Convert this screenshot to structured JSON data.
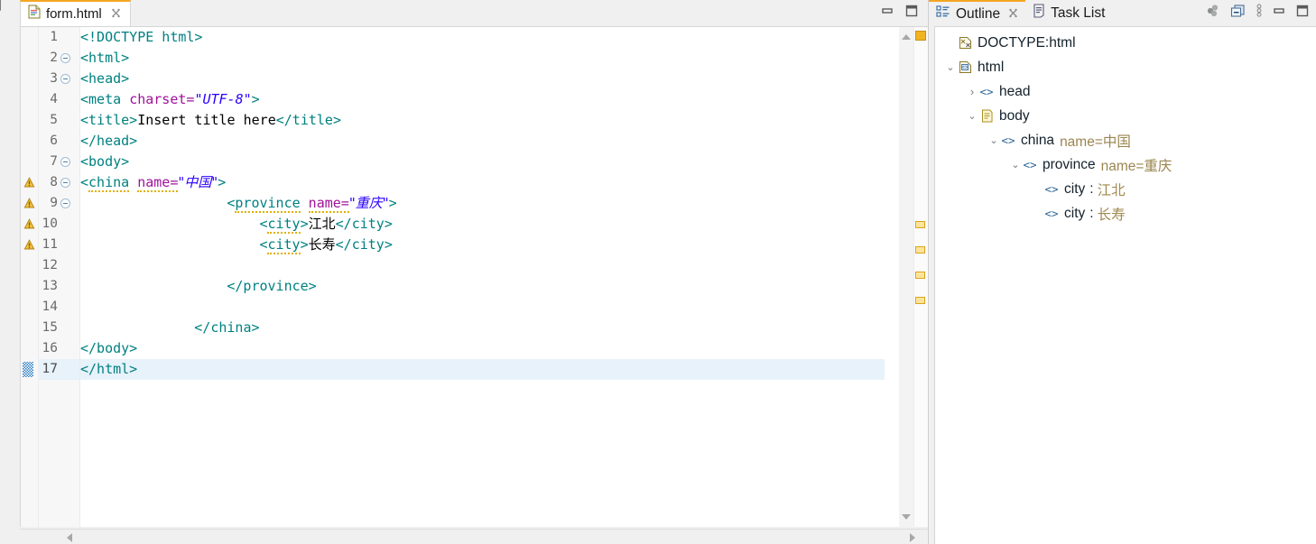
{
  "editor": {
    "tab": {
      "label": "form.html",
      "close": "✕",
      "icon": "html-file-icon"
    },
    "window_controls": {
      "minimize": "minimize-icon",
      "maximize": "maximize-icon"
    },
    "lines": [
      {
        "num": "1",
        "warn": false,
        "fold": false,
        "indent": 0,
        "tokens": [
          {
            "t": "tag",
            "v": "<!DOCTYPE html>"
          }
        ]
      },
      {
        "num": "2",
        "warn": false,
        "fold": true,
        "indent": 0,
        "tokens": [
          {
            "t": "tag",
            "v": "<html>"
          }
        ]
      },
      {
        "num": "3",
        "warn": false,
        "fold": true,
        "indent": 0,
        "tokens": [
          {
            "t": "tag",
            "v": "<head>"
          }
        ]
      },
      {
        "num": "4",
        "warn": false,
        "fold": false,
        "indent": 0,
        "tokens": [
          {
            "t": "tag",
            "v": "<meta "
          },
          {
            "t": "attr",
            "v": "charset="
          },
          {
            "t": "val",
            "v": "\"UTF-8\""
          },
          {
            "t": "tag",
            "v": ">"
          }
        ]
      },
      {
        "num": "5",
        "warn": false,
        "fold": false,
        "indent": 0,
        "tokens": [
          {
            "t": "tag",
            "v": "<title>"
          },
          {
            "t": "txt",
            "v": "Insert title here"
          },
          {
            "t": "tag",
            "v": "</title>"
          }
        ]
      },
      {
        "num": "6",
        "warn": false,
        "fold": false,
        "indent": 0,
        "tokens": [
          {
            "t": "tag",
            "v": "</head>"
          }
        ]
      },
      {
        "num": "7",
        "warn": false,
        "fold": true,
        "indent": 0,
        "tokens": [
          {
            "t": "tag",
            "v": "<body>"
          }
        ]
      },
      {
        "num": "8",
        "warn": true,
        "fold": true,
        "indent": 0,
        "tokens": [
          {
            "t": "tag",
            "v": "<"
          },
          {
            "t": "tag squig",
            "v": "china"
          },
          {
            "t": "tag",
            "v": " "
          },
          {
            "t": "attr squig",
            "v": "name="
          },
          {
            "t": "val",
            "v": "\"中国\""
          },
          {
            "t": "tag",
            "v": ">"
          }
        ]
      },
      {
        "num": "9",
        "warn": true,
        "fold": true,
        "indent": 18,
        "tokens": [
          {
            "t": "tag",
            "v": "<"
          },
          {
            "t": "tag squig",
            "v": "province"
          },
          {
            "t": "tag",
            "v": " "
          },
          {
            "t": "attr squig",
            "v": "name="
          },
          {
            "t": "val",
            "v": "\"重庆\""
          },
          {
            "t": "tag",
            "v": ">"
          }
        ]
      },
      {
        "num": "10",
        "warn": true,
        "fold": false,
        "indent": 22,
        "tokens": [
          {
            "t": "tag",
            "v": "<"
          },
          {
            "t": "tag squig",
            "v": "city"
          },
          {
            "t": "tag",
            "v": ">"
          },
          {
            "t": "txt",
            "v": "江北"
          },
          {
            "t": "tag",
            "v": "</city>"
          }
        ]
      },
      {
        "num": "11",
        "warn": true,
        "fold": false,
        "indent": 22,
        "tokens": [
          {
            "t": "tag",
            "v": "<"
          },
          {
            "t": "tag squig",
            "v": "city"
          },
          {
            "t": "tag",
            "v": ">"
          },
          {
            "t": "txt",
            "v": "长寿"
          },
          {
            "t": "tag",
            "v": "</city>"
          }
        ]
      },
      {
        "num": "12",
        "warn": false,
        "fold": false,
        "indent": 0,
        "tokens": []
      },
      {
        "num": "13",
        "warn": false,
        "fold": false,
        "indent": 18,
        "tokens": [
          {
            "t": "tag",
            "v": "</province>"
          }
        ]
      },
      {
        "num": "14",
        "warn": false,
        "fold": false,
        "indent": 0,
        "tokens": []
      },
      {
        "num": "15",
        "warn": false,
        "fold": false,
        "indent": 14,
        "tokens": [
          {
            "t": "tag",
            "v": "</china>"
          }
        ]
      },
      {
        "num": "16",
        "warn": false,
        "fold": false,
        "indent": 0,
        "tokens": [
          {
            "t": "tag",
            "v": "</body>"
          }
        ]
      },
      {
        "num": "17",
        "warn": false,
        "fold": false,
        "indent": 0,
        "current": true,
        "tokens": [
          {
            "t": "tag",
            "v": "</html>"
          }
        ]
      }
    ],
    "ruler_markers": 5,
    "scroll": {
      "up": "scroll-up-arrow",
      "down": "scroll-down-arrow",
      "left": "scroll-left-arrow",
      "right": "scroll-right-arrow"
    }
  },
  "right_panel": {
    "tabs": [
      {
        "label": "Outline",
        "icon": "outline-icon",
        "close": "✕",
        "active": true
      },
      {
        "label": "Task List",
        "icon": "tasklist-icon",
        "active": false
      }
    ],
    "toolbar": [
      {
        "name": "sort-icon"
      },
      {
        "name": "collapse-all-icon"
      },
      {
        "name": "view-menu-icon"
      },
      {
        "name": "minimize-icon"
      },
      {
        "name": "maximize-icon"
      }
    ],
    "outline": [
      {
        "depth": 0,
        "twist": "",
        "icon": "doctype-icon",
        "label": "DOCTYPE:html",
        "attr": "",
        "sep": "",
        "val": ""
      },
      {
        "depth": 0,
        "twist": "∨",
        "icon": "html-icon",
        "label": "html",
        "attr": "",
        "sep": "",
        "val": ""
      },
      {
        "depth": 1,
        "twist": "›",
        "icon": "element-icon",
        "label": "head",
        "attr": "",
        "sep": "",
        "val": ""
      },
      {
        "depth": 1,
        "twist": "∨",
        "icon": "body-icon",
        "label": "body",
        "attr": "",
        "sep": "",
        "val": ""
      },
      {
        "depth": 2,
        "twist": "∨",
        "icon": "element-icon",
        "label": "china",
        "attr": "name=中国",
        "sep": "",
        "val": ""
      },
      {
        "depth": 3,
        "twist": "∨",
        "icon": "element-icon",
        "label": "province",
        "attr": "name=重庆",
        "sep": "",
        "val": ""
      },
      {
        "depth": 4,
        "twist": "",
        "icon": "element-icon",
        "label": "city",
        "attr": "",
        "sep": ":",
        "val": "江北"
      },
      {
        "depth": 4,
        "twist": "",
        "icon": "element-icon",
        "label": "city",
        "attr": "",
        "sep": ":",
        "val": "长寿"
      }
    ]
  },
  "colors": {
    "tag": "#008080",
    "attribute": "#a0119c",
    "value": "#2a00ff",
    "text": "#000000",
    "tab_accent": "#f5a623",
    "current_line": "#e8f2fb",
    "warning": "#f2b322",
    "outline_attr": "#9b8651"
  }
}
